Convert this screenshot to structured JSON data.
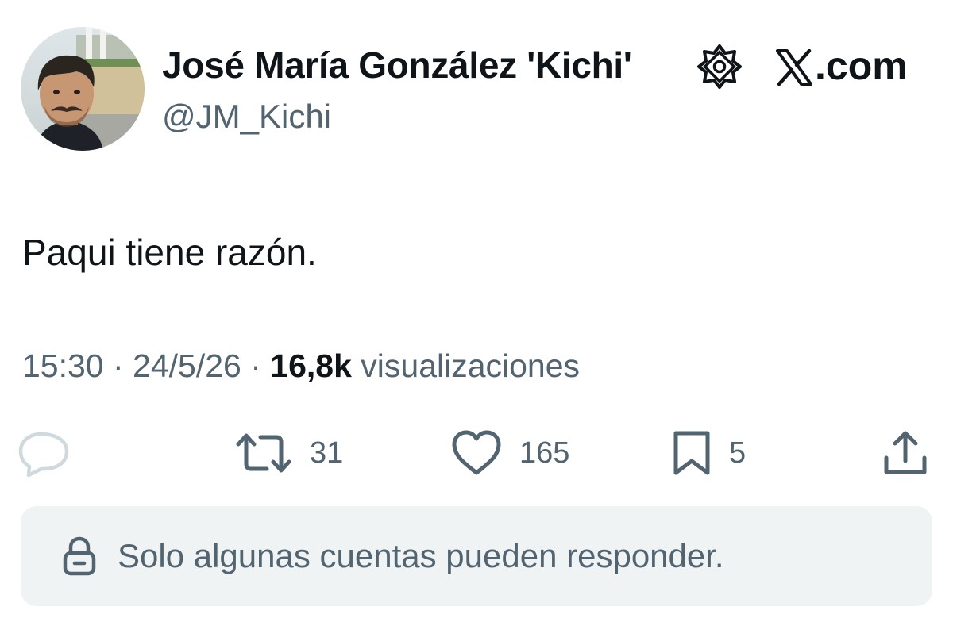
{
  "author": {
    "display_name": "José María González 'Kichi'",
    "handle": "@JM_Kichi",
    "avatar_icon": "profile-photo",
    "badge_icon": "verified-badge-icon"
  },
  "brand": {
    "label": ".com",
    "icon": "x-logo-icon"
  },
  "tweet": {
    "text": "Paqui tiene razón."
  },
  "meta": {
    "time": "15:30",
    "separator_1": " · ",
    "date": "24/5/26",
    "separator_2": " · ",
    "views_count": "16,8k",
    "views_label": " visualizaciones"
  },
  "actions": {
    "reply": {
      "icon": "reply-icon",
      "count": ""
    },
    "retweet": {
      "icon": "retweet-icon",
      "count": "31"
    },
    "like": {
      "icon": "heart-icon",
      "count": "165"
    },
    "bookmark": {
      "icon": "bookmark-icon",
      "count": "5"
    },
    "share": {
      "icon": "share-icon"
    }
  },
  "reply_restriction": {
    "icon": "lock-icon",
    "text": "Solo algunas cuentas pueden responder."
  },
  "colors": {
    "text_primary": "#0f1419",
    "text_secondary": "#536471",
    "reply_bar_bg": "#eff3f4",
    "background": "#ffffff"
  }
}
